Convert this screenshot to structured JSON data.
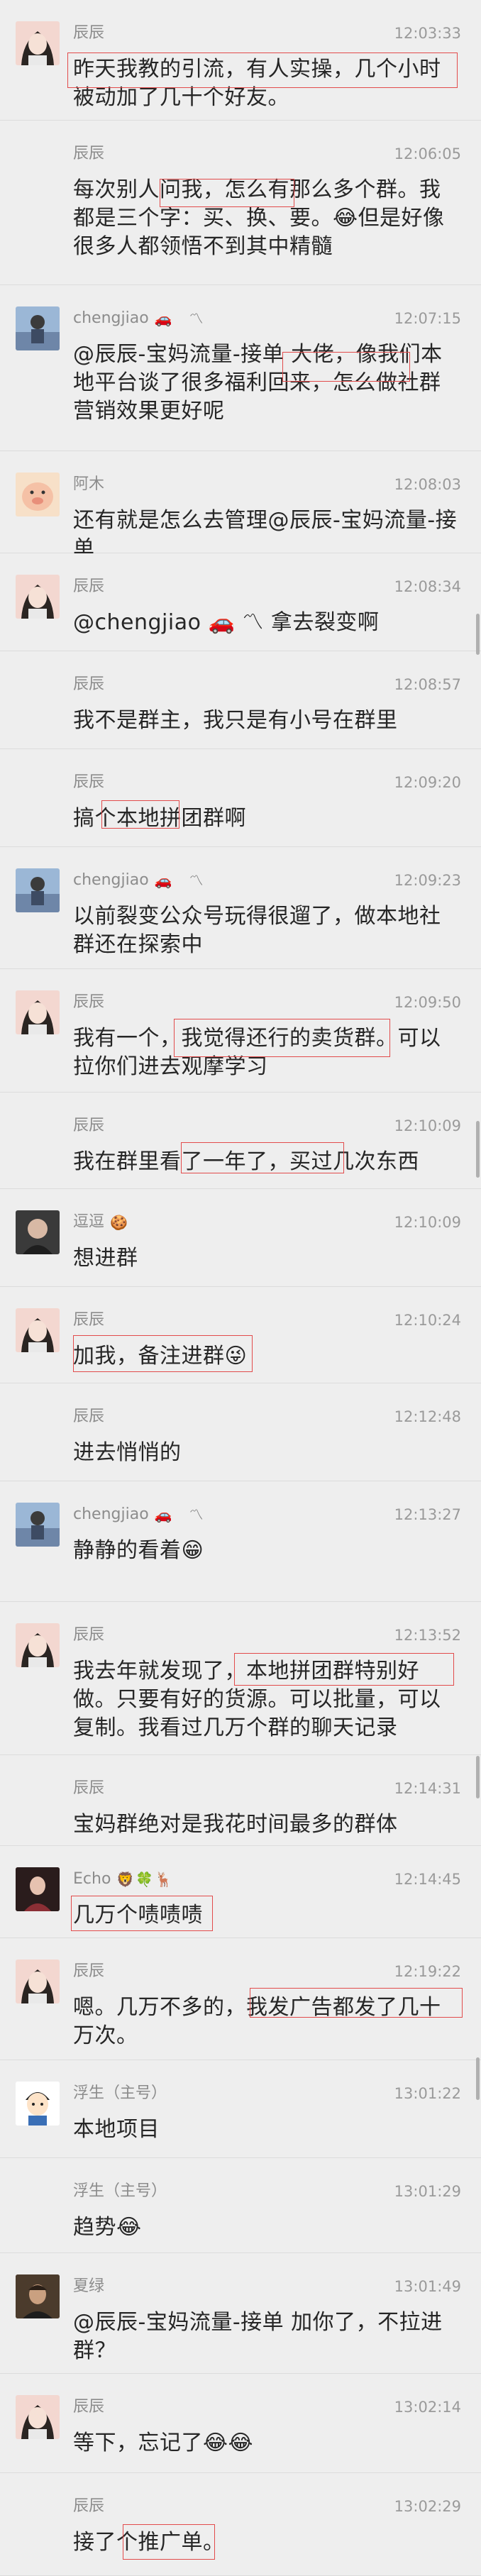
{
  "messages": [
    {
      "sender": "辰辰",
      "badges": [],
      "time": "12:03:33",
      "text": "昨天我教的引流，有人实操，几个小时被动加了几十个好友。",
      "avatar": "girl-avatar",
      "avatar_color": "#f3d7d0"
    },
    {
      "sender": "辰辰",
      "badges": [],
      "time": "12:06:05",
      "text": "每次别人问我，怎么有那么多个群。我都是三个字：买、换、要。😂但是好像很多人都领悟不到其中精髓",
      "avatar": "none"
    },
    {
      "sender": "chengjiao",
      "badges": [
        "🚗",
        "〽"
      ],
      "time": "12:07:15",
      "text": "@辰辰-宝妈流量-接单 大佬，像我们本地平台谈了很多福利回来，怎么做社群营销效果更好呢",
      "avatar": "person-avatar",
      "avatar_color": "#9bb7d6"
    },
    {
      "sender": "阿木",
      "badges": [],
      "time": "12:08:03",
      "text": "还有就是怎么去管理@辰辰-宝妈流量-接单",
      "avatar": "pig-avatar",
      "avatar_color": "#f7e0c8"
    },
    {
      "sender": "辰辰",
      "badges": [],
      "time": "12:08:34",
      "text": "@chengjiao 🚗 〽 拿去裂变啊",
      "avatar": "girl-avatar",
      "avatar_color": "#f3d7d0"
    },
    {
      "sender": "辰辰",
      "badges": [],
      "time": "12:08:57",
      "text": "我不是群主，我只是有小号在群里",
      "avatar": "none"
    },
    {
      "sender": "辰辰",
      "badges": [],
      "time": "12:09:20",
      "text": "搞个本地拼团群啊",
      "avatar": "none"
    },
    {
      "sender": "chengjiao",
      "badges": [
        "🚗",
        "〽"
      ],
      "time": "12:09:23",
      "text": "以前裂变公众号玩得很遛了，做本地社群还在探索中",
      "avatar": "person-avatar",
      "avatar_color": "#9bb7d6"
    },
    {
      "sender": "辰辰",
      "badges": [],
      "time": "12:09:50",
      "text": "我有一个，我觉得还行的卖货群。可以拉你们进去观摩学习",
      "avatar": "girl-avatar",
      "avatar_color": "#f3d7d0"
    },
    {
      "sender": "辰辰",
      "badges": [],
      "time": "12:10:09",
      "text": "我在群里看了一年了，买过几次东西",
      "avatar": "none"
    },
    {
      "sender": "逗逗",
      "badges": [
        "🍪"
      ],
      "time": "12:10:09",
      "text": "想进群",
      "avatar": "dark-avatar",
      "avatar_color": "#3a3a3a"
    },
    {
      "sender": "辰辰",
      "badges": [],
      "time": "12:10:24",
      "text": "加我，备注进群😜",
      "avatar": "girl-avatar",
      "avatar_color": "#f3d7d0"
    },
    {
      "sender": "辰辰",
      "badges": [],
      "time": "12:12:48",
      "text": "进去悄悄的",
      "avatar": "none"
    },
    {
      "sender": "chengjiao",
      "badges": [
        "🚗",
        "〽"
      ],
      "time": "12:13:27",
      "text": "静静的看着😁",
      "avatar": "person-avatar",
      "avatar_color": "#9bb7d6"
    },
    {
      "sender": "辰辰",
      "badges": [],
      "time": "12:13:52",
      "text": "我去年就发现了，本地拼团群特别好做。只要有好的货源。可以批量，可以复制。我看过几万个群的聊天记录",
      "avatar": "girl-avatar",
      "avatar_color": "#f3d7d0"
    },
    {
      "sender": "辰辰",
      "badges": [],
      "time": "12:14:31",
      "text": "宝妈群绝对是我花时间最多的群体",
      "avatar": "none"
    },
    {
      "sender": "Echo",
      "badges": [
        "🦁",
        "🍀",
        "🦌"
      ],
      "time": "12:14:45",
      "text": "几万个啧啧啧",
      "avatar": "woman-avatar",
      "avatar_color": "#6e3b3b"
    },
    {
      "sender": "辰辰",
      "badges": [],
      "time": "12:19:22",
      "text": "嗯。几万不多的，我发广告都发了几十万次。",
      "avatar": "girl-avatar",
      "avatar_color": "#f3d7d0"
    },
    {
      "sender": "浮生（主号）",
      "badges": [],
      "time": "13:01:22",
      "text": "本地项目",
      "avatar": "cartoon-avatar",
      "avatar_color": "#ffffff"
    },
    {
      "sender": "浮生（主号）",
      "badges": [],
      "time": "13:01:29",
      "text": "趋势😂",
      "avatar": "none"
    },
    {
      "sender": "夏绿",
      "badges": [],
      "time": "13:01:49",
      "text": "@辰辰-宝妈流量-接单 加你了，不拉进群？",
      "avatar": "man-avatar",
      "avatar_color": "#5a4a3a"
    },
    {
      "sender": "辰辰",
      "badges": [],
      "time": "13:02:14",
      "text": "等下，忘记了😂😂",
      "avatar": "girl-avatar",
      "avatar_color": "#f3d7d0"
    },
    {
      "sender": "辰辰",
      "badges": [],
      "time": "13:02:29",
      "text": "接了个推广单。",
      "avatar": "none"
    }
  ]
}
